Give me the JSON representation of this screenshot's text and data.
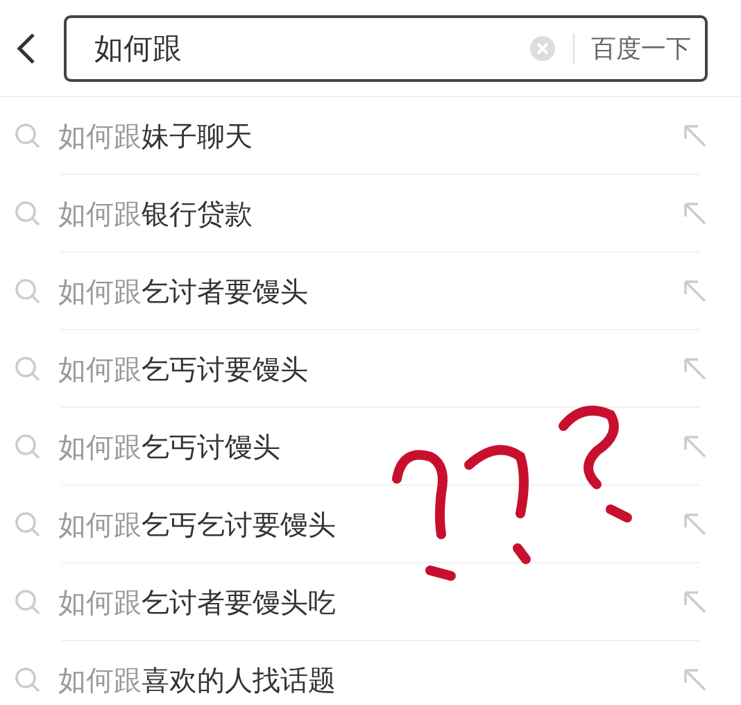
{
  "search": {
    "value": "如何跟",
    "submit_label": "百度一下"
  },
  "suggestions": [
    {
      "matched": "如何跟",
      "completion": "妹子聊天"
    },
    {
      "matched": "如何跟",
      "completion": "银行贷款"
    },
    {
      "matched": "如何跟",
      "completion": "乞讨者要馒头"
    },
    {
      "matched": "如何跟",
      "completion": "乞丐讨要馒头"
    },
    {
      "matched": "如何跟",
      "completion": "乞丐讨馒头"
    },
    {
      "matched": "如何跟",
      "completion": "乞丐乞讨要馒头"
    },
    {
      "matched": "如何跟",
      "completion": "乞讨者要馒头吃"
    },
    {
      "matched": "如何跟",
      "completion": "喜欢的人找话题"
    }
  ]
}
